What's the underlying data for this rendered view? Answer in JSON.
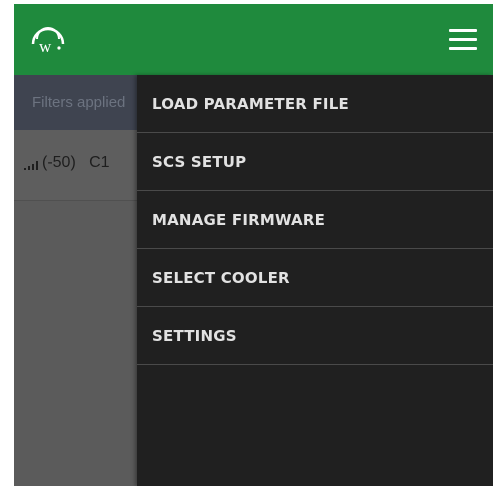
{
  "colors": {
    "appbar": "#1f8a3d",
    "drawer": "#202020",
    "drawer_text": "#e2e2e2",
    "filters_bar": "#3f4450",
    "list_bg": "#5b5b5b"
  },
  "appbar": {
    "logo_icon": "w-logo-icon",
    "menu_icon": "hamburger-menu-icon"
  },
  "filters": {
    "text": "Filters applied"
  },
  "device": {
    "signal_icon": "signal-strength-icon",
    "text": "(-50)   C1"
  },
  "drawer": {
    "items": [
      {
        "label": "LOAD PARAMETER FILE"
      },
      {
        "label": "SCS SETUP"
      },
      {
        "label": "MANAGE FIRMWARE"
      },
      {
        "label": "SELECT COOLER"
      },
      {
        "label": "SETTINGS"
      }
    ]
  }
}
